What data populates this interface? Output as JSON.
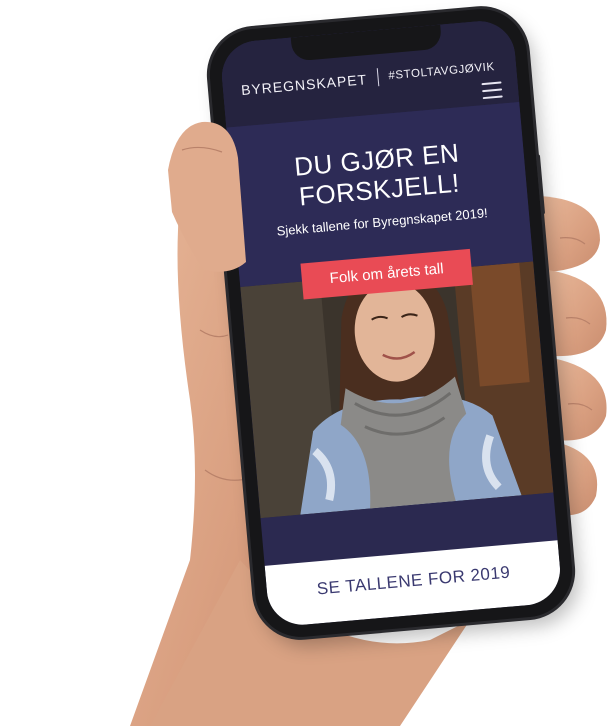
{
  "header": {
    "brand": "BYREGNSKAPET",
    "hashtag": "#STOLTAVGJØVIK"
  },
  "hero": {
    "title_line1": "DU GJØR EN",
    "title_line2": "FORSKJELL!",
    "subtitle": "Sjekk tallene for Byregnskapet 2019!",
    "cta_label": "Folk om årets tall"
  },
  "footer": {
    "label": "SE TALLENE FOR 2019"
  },
  "icons": {
    "menu": "hamburger-menu-icon"
  },
  "colors": {
    "header_bg": "#25233f",
    "hero_bg": "#2d2b56",
    "cta_bg": "#e94b55",
    "footer_text": "#3a3970"
  }
}
